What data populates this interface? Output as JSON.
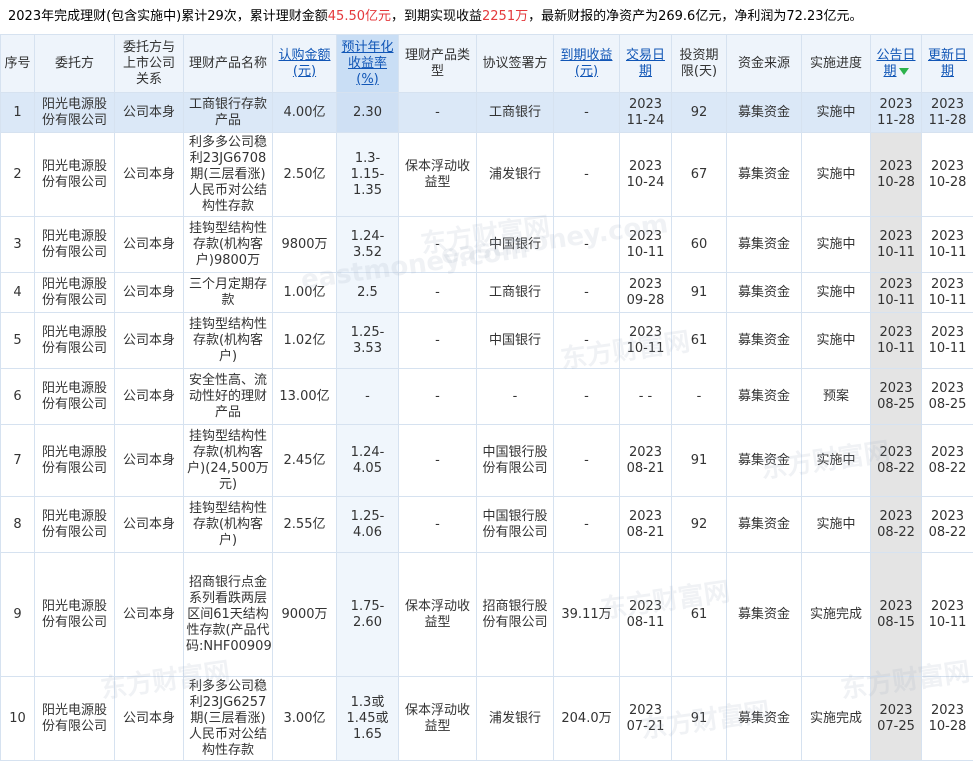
{
  "summary": {
    "part1": "2023年完成理财(包含实施中)累计29次，累计理财金额",
    "total_amount": "45.50亿元",
    "part2": "，到期实现收益",
    "total_income": "2251万",
    "part3": "，最新财报的净资产为269.6亿元，净利润为72.23亿元。"
  },
  "headers": [
    {
      "key": "no",
      "label": "序号",
      "link": false
    },
    {
      "key": "trustor",
      "label": "委托方",
      "link": false
    },
    {
      "key": "relation",
      "label": "委托方与上市公司关系",
      "link": false
    },
    {
      "key": "product",
      "label": "理财产品名称",
      "link": false
    },
    {
      "key": "amount",
      "label": "认购金额(元)",
      "link": true
    },
    {
      "key": "rate",
      "label": "预计年化收益率(%)",
      "link": true,
      "highlight": true
    },
    {
      "key": "type",
      "label": "理财产品类型",
      "link": false
    },
    {
      "key": "signer",
      "label": "协议签署方",
      "link": false
    },
    {
      "key": "income",
      "label": "到期收益(元)",
      "link": true
    },
    {
      "key": "trade_date",
      "label": "交易日期",
      "link": true
    },
    {
      "key": "term",
      "label": "投资期限(天)",
      "link": false
    },
    {
      "key": "source",
      "label": "资金来源",
      "link": false
    },
    {
      "key": "progress",
      "label": "实施进度",
      "link": false
    },
    {
      "key": "ann_date",
      "label": "公告日期",
      "link": true,
      "sort_icon": "sort-down-icon"
    },
    {
      "key": "upd_date",
      "label": "更新日期",
      "link": true
    }
  ],
  "rows": [
    {
      "no": "1",
      "trustor": "阳光电源股份有限公司",
      "relation": "公司本身",
      "product": "工商银行存款产品",
      "amount": "4.00亿",
      "rate": "2.30",
      "type": "-",
      "signer": "工商银行",
      "income": "-",
      "trade_date": "2023 11-24",
      "term": "92",
      "source": "募集资金",
      "progress": "实施中",
      "ann_date": "2023 11-28",
      "upd_date": "2023 11-28"
    },
    {
      "no": "2",
      "trustor": "阳光电源股份有限公司",
      "relation": "公司本身",
      "product": "利多多公司稳利23JG6708期(三层看涨)人民币对公结构性存款",
      "amount": "2.50亿",
      "rate": "1.3-1.15-1.35",
      "type": "保本浮动收益型",
      "signer": "浦发银行",
      "income": "-",
      "trade_date": "2023 10-24",
      "term": "67",
      "source": "募集资金",
      "progress": "实施中",
      "ann_date": "2023 10-28",
      "upd_date": "2023 10-28"
    },
    {
      "no": "3",
      "trustor": "阳光电源股份有限公司",
      "relation": "公司本身",
      "product": "挂钩型结构性存款(机构客户)9800万",
      "amount": "9800万",
      "rate": "1.24-3.52",
      "type": "-",
      "signer": "中国银行",
      "income": "-",
      "trade_date": "2023 10-11",
      "term": "60",
      "source": "募集资金",
      "progress": "实施中",
      "ann_date": "2023 10-11",
      "upd_date": "2023 10-11"
    },
    {
      "no": "4",
      "trustor": "阳光电源股份有限公司",
      "relation": "公司本身",
      "product": "三个月定期存款",
      "amount": "1.00亿",
      "rate": "2.5",
      "type": "-",
      "signer": "工商银行",
      "income": "-",
      "trade_date": "2023 09-28",
      "term": "91",
      "source": "募集资金",
      "progress": "实施中",
      "ann_date": "2023 10-11",
      "upd_date": "2023 10-11"
    },
    {
      "no": "5",
      "trustor": "阳光电源股份有限公司",
      "relation": "公司本身",
      "product": "挂钩型结构性存款(机构客户)",
      "amount": "1.02亿",
      "rate": "1.25-3.53",
      "type": "-",
      "signer": "中国银行",
      "income": "-",
      "trade_date": "2023 10-11",
      "term": "61",
      "source": "募集资金",
      "progress": "实施中",
      "ann_date": "2023 10-11",
      "upd_date": "2023 10-11"
    },
    {
      "no": "6",
      "trustor": "阳光电源股份有限公司",
      "relation": "公司本身",
      "product": "安全性高、流动性好的理财产品",
      "amount": "13.00亿",
      "rate": "-",
      "type": "-",
      "signer": "-",
      "income": "-",
      "trade_date": "- -",
      "term": "-",
      "source": "募集资金",
      "progress": "预案",
      "ann_date": "2023 08-25",
      "upd_date": "2023 08-25"
    },
    {
      "no": "7",
      "trustor": "阳光电源股份有限公司",
      "relation": "公司本身",
      "product": "挂钩型结构性存款(机构客户)(24,500万元)",
      "amount": "2.45亿",
      "rate": "1.24-4.05",
      "type": "-",
      "signer": "中国银行股份有限公司",
      "income": "-",
      "trade_date": "2023 08-21",
      "term": "91",
      "source": "募集资金",
      "progress": "实施中",
      "ann_date": "2023 08-22",
      "upd_date": "2023 08-22"
    },
    {
      "no": "8",
      "trustor": "阳光电源股份有限公司",
      "relation": "公司本身",
      "product": "挂钩型结构性存款(机构客户)",
      "amount": "2.55亿",
      "rate": "1.25-4.06",
      "type": "-",
      "signer": "中国银行股份有限公司",
      "income": "-",
      "trade_date": "2023 08-21",
      "term": "92",
      "source": "募集资金",
      "progress": "实施中",
      "ann_date": "2023 08-22",
      "upd_date": "2023 08-22"
    },
    {
      "no": "9",
      "trustor": "阳光电源股份有限公司",
      "relation": "公司本身",
      "product": "招商银行点金系列看跌两层区间61天结构性存款(产品代码:NHF00909)",
      "amount": "9000万",
      "rate": "1.75-2.60",
      "type": "保本浮动收益型",
      "signer": "招商银行股份有限公司",
      "income": "39.11万",
      "trade_date": "2023 08-11",
      "term": "61",
      "source": "募集资金",
      "progress": "实施完成",
      "ann_date": "2023 08-15",
      "upd_date": "2023 10-11"
    },
    {
      "no": "10",
      "trustor": "阳光电源股份有限公司",
      "relation": "公司本身",
      "product": "利多多公司稳利23JG6257期(三层看涨)人民币对公结构性存款",
      "amount": "3.00亿",
      "rate": "1.3或1.45或1.65",
      "type": "保本浮动收益型",
      "signer": "浦发银行",
      "income": "204.0万",
      "trade_date": "2023 07-21",
      "term": "91",
      "source": "募集资金",
      "progress": "实施完成",
      "ann_date": "2023 07-25",
      "upd_date": "2023 10-28"
    }
  ],
  "watermarks": [
    "东方财富网",
    "eastmoney.com"
  ]
}
